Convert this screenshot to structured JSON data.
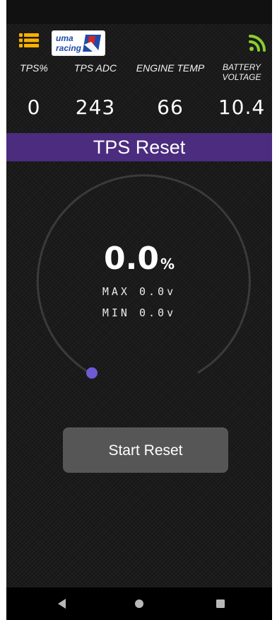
{
  "app": {
    "brand_logo_text": "uma racing",
    "signal_color": "#8bcf2f",
    "accent_color": "#4b2c7f",
    "menu_icon_color": "#ffb000",
    "logo_flag_colors": {
      "blue": "#1f4aa8",
      "red": "#d1272b"
    }
  },
  "metrics": [
    {
      "label": "TPS%",
      "value": "0"
    },
    {
      "label": "TPS ADC",
      "value": "243"
    },
    {
      "label": "ENGINE TEMP",
      "value": "66"
    },
    {
      "label_line1": "BATTERY",
      "label_line2": "VOLTAGE",
      "value": "10.4"
    }
  ],
  "banner": {
    "title": "TPS Reset"
  },
  "gauge": {
    "value": "0.0",
    "unit": "%",
    "max_label": "MAX",
    "max_value": "0.0v",
    "min_label": "MIN",
    "min_value": "0.0v",
    "level": 0,
    "arc_color": "#3a3a3a",
    "indicator_color": "#6e5ad3"
  },
  "actions": {
    "start_reset_label": "Start Reset"
  },
  "navigation": {
    "back_icon": "back-icon",
    "home_icon": "home-icon",
    "recent_icon": "recent-apps-icon"
  }
}
